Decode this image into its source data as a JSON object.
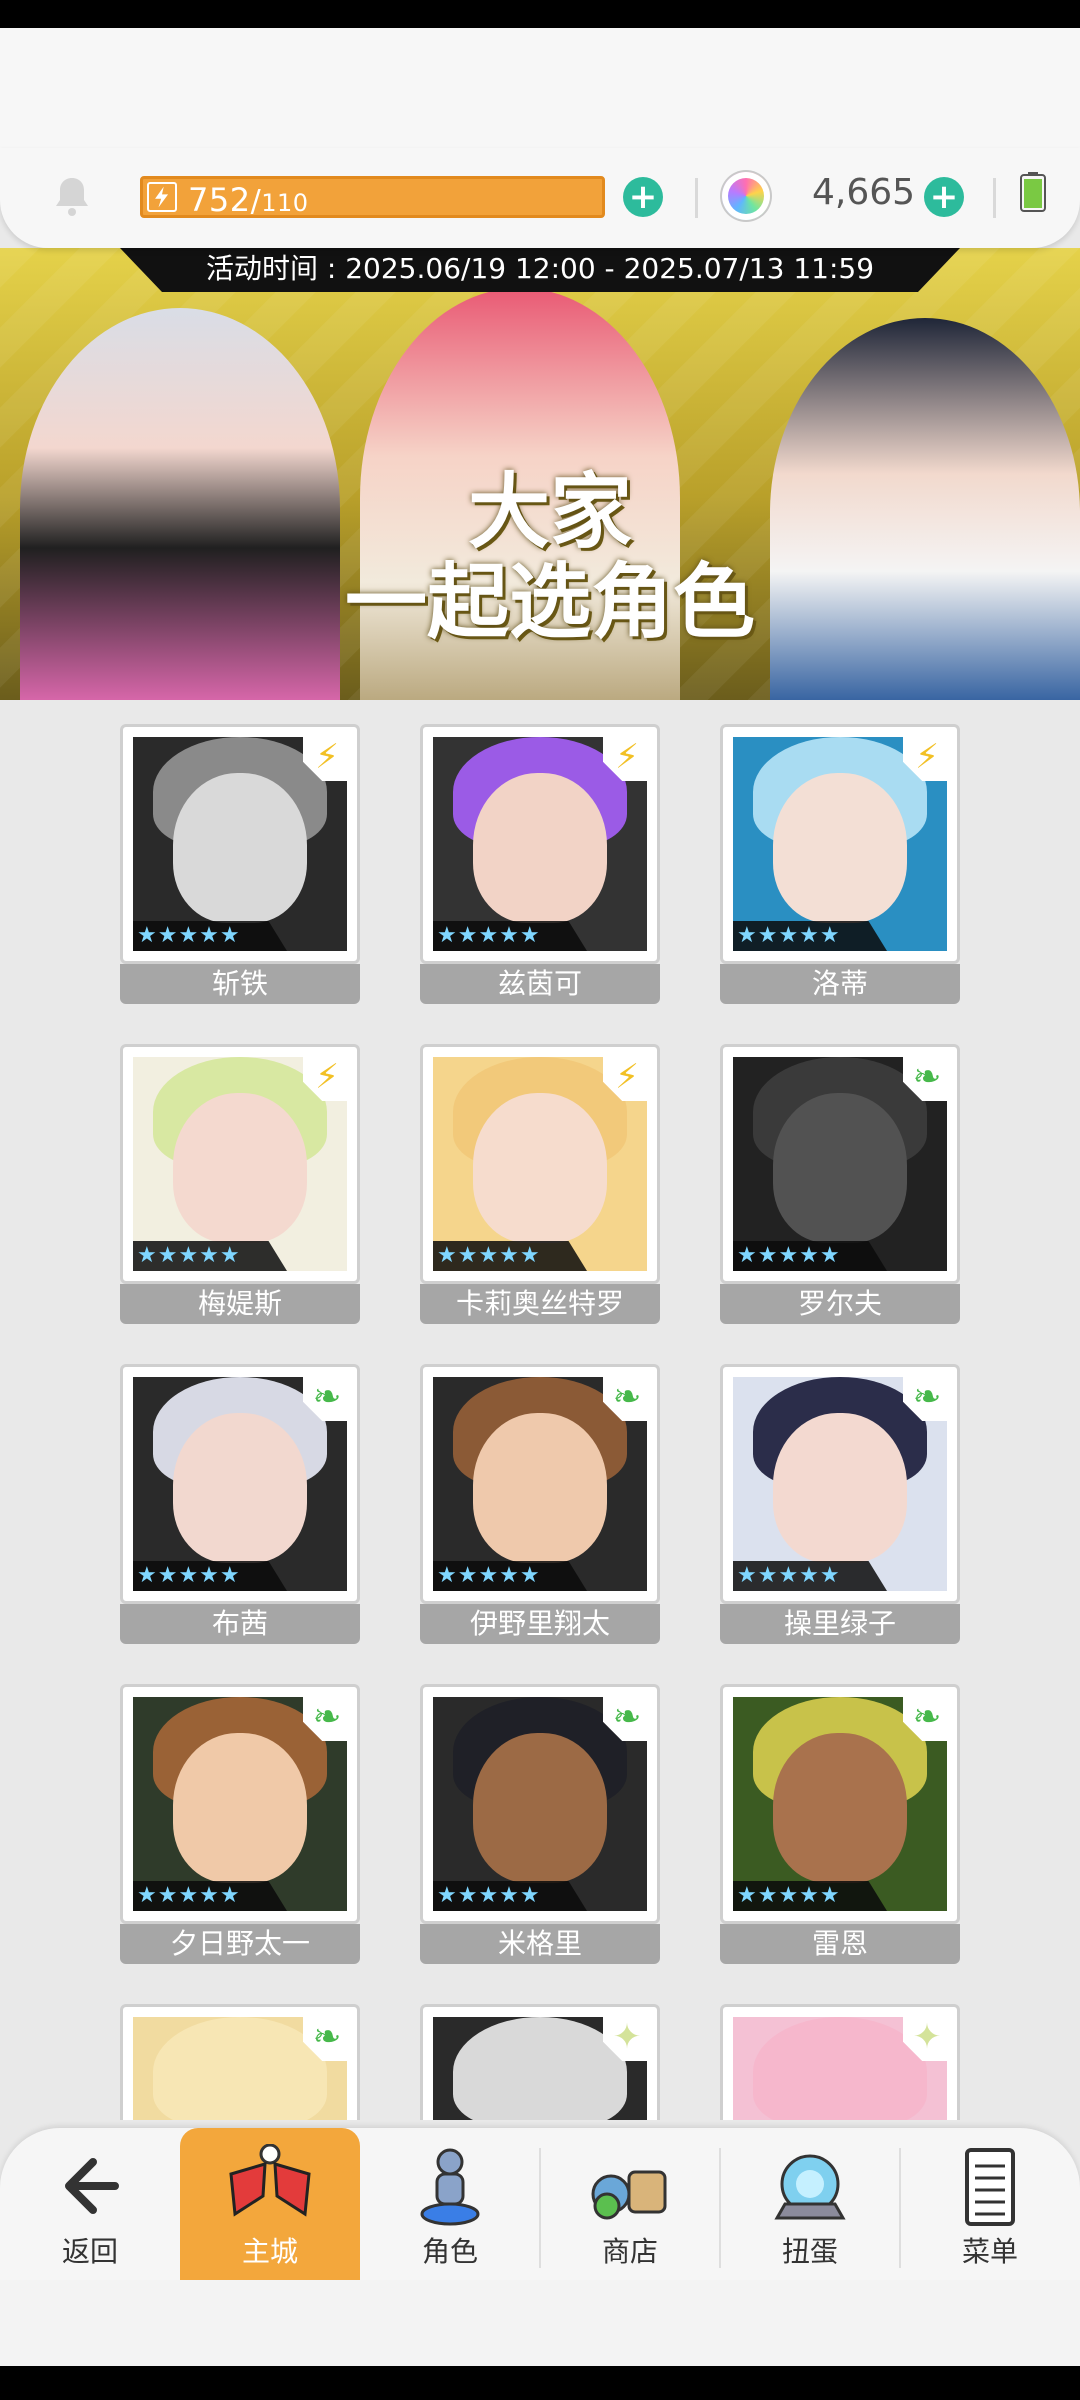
{
  "header": {
    "energy_current": "752",
    "energy_separator": "/",
    "energy_max": "110",
    "gem_count": "4,665"
  },
  "banner": {
    "time_text": "活动时间 : 2025.06/19 12:00 - 2025.07/13 11:59",
    "title_line1": "大家",
    "title_line2": "一起选角色"
  },
  "characters": [
    {
      "name": "斩铁",
      "element": "thunder-icon",
      "stars": "★★★★★"
    },
    {
      "name": "兹茵可",
      "element": "thunder-icon",
      "stars": "★★★★★"
    },
    {
      "name": "洛蒂",
      "element": "thunder-icon",
      "stars": "★★★★★"
    },
    {
      "name": "梅媞斯",
      "element": "thunder-icon",
      "stars": "★★★★★"
    },
    {
      "name": "卡莉奥丝特罗",
      "element": "thunder-icon",
      "stars": "★★★★★"
    },
    {
      "name": "罗尔夫",
      "element": "wind-icon",
      "stars": "★★★★★"
    },
    {
      "name": "布茜",
      "element": "wind-icon",
      "stars": "★★★★★"
    },
    {
      "name": "伊野里翔太",
      "element": "wind-icon",
      "stars": "★★★★★"
    },
    {
      "name": "操里绿子",
      "element": "wind-icon",
      "stars": "★★★★★"
    },
    {
      "name": "夕日野太一",
      "element": "wind-icon",
      "stars": "★★★★★"
    },
    {
      "name": "米格里",
      "element": "wind-icon",
      "stars": "★★★★★"
    },
    {
      "name": "雷恩",
      "element": "wind-icon",
      "stars": "★★★★★"
    }
  ],
  "nav": {
    "back": "返回",
    "main_city": "主城",
    "characters": "角色",
    "shop": "商店",
    "gacha": "扭蛋",
    "menu": "菜单"
  },
  "colors": {
    "accent": "#f3a73c",
    "energy": "#f2a23a",
    "plus": "#2dbb9c",
    "thunder": "#f2c025",
    "wind": "#46b84a"
  }
}
